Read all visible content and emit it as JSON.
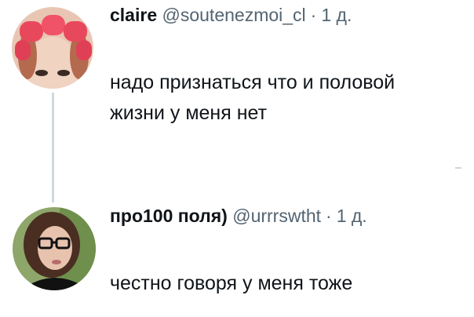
{
  "tweets": [
    {
      "author_name": "claire",
      "handle": "@soutenezmoi_cl",
      "separator": "·",
      "time": "1 д.",
      "text_lines": [
        "надо признаться что и половой",
        "жизни у меня нет"
      ],
      "avatar": "avatar-hair-rollers"
    },
    {
      "author_name": "про100 поля)",
      "handle": "@urrrswtht",
      "separator": "·",
      "time": "1 д.",
      "text_lines": [
        "честно говоря у меня тоже"
      ],
      "avatar": "avatar-glasses-portrait"
    }
  ]
}
